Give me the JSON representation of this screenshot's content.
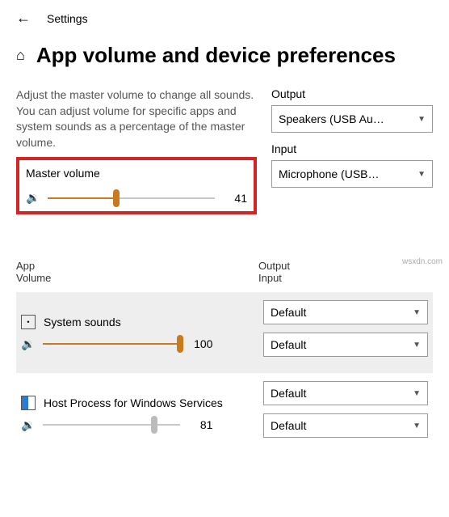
{
  "header": {
    "title": "Settings"
  },
  "page": {
    "title": "App volume and device preferences",
    "description": "Adjust the master volume to change all sounds. You can adjust volume for specific apps and system sounds as a percentage of the master volume."
  },
  "output": {
    "label": "Output",
    "value": "Speakers (USB Au…"
  },
  "input": {
    "label": "Input",
    "value": "Microphone (USB…"
  },
  "master": {
    "label": "Master volume",
    "value": "41",
    "pct": 41
  },
  "appsHeader": {
    "left1": "App",
    "left2": "Volume",
    "right1": "Output",
    "right2": "Input"
  },
  "apps": [
    {
      "name": "System sounds",
      "value": "100",
      "pct": 100,
      "output": "Default",
      "input": "Default"
    },
    {
      "name": "Host Process for Windows Services",
      "value": "81",
      "pct": 81,
      "output": "Default",
      "input": "Default"
    }
  ],
  "watermark": "wsxdn.com"
}
